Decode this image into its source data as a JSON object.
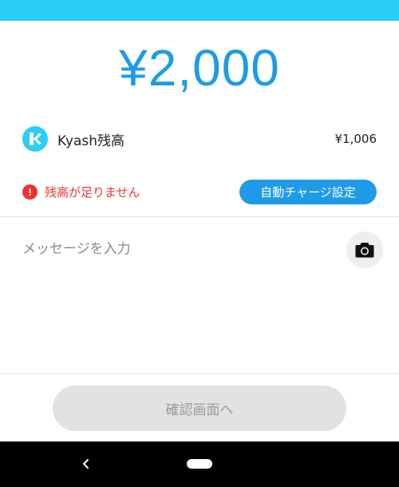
{
  "amount": "¥2,000",
  "balance": {
    "label": "Kyash残高",
    "value": "¥1,006",
    "logo_icon": "kyash-logo-icon"
  },
  "warning": {
    "icon": "exclamation-icon",
    "icon_glyph": "!",
    "text": "残高が足りません",
    "auto_charge_label": "自動チャージ設定"
  },
  "message": {
    "placeholder": "メッセージを入力",
    "camera_icon": "camera-icon"
  },
  "confirm_label": "確認画面へ",
  "colors": {
    "accent": "#1e9be6",
    "status_bar": "#2ccdf7",
    "warning": "#ee3135",
    "disabled_button": "#e2e2e2"
  },
  "nav": {
    "back_icon": "back-chevron-icon",
    "home_icon": "home-pill-icon"
  }
}
